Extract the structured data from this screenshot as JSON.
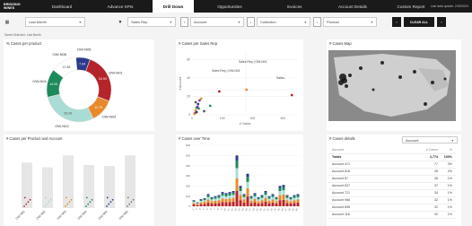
{
  "app": {
    "logo_line1": "BRIDGING",
    "logo_line2": "WINES",
    "last_modified": "Last data update: 2/25/2024"
  },
  "nav": {
    "tabs": [
      "Dashboard",
      "Advance KPIs",
      "Drill Down",
      "Opportunities",
      "Invoices",
      "Account Details",
      "Custom Report"
    ],
    "active": "Drill Down"
  },
  "filters": {
    "date_label": "Last Month",
    "sales_rep": "Sales Rep",
    "account": "Account",
    "collection": "Collection",
    "product": "Product",
    "clear_all": "CLEAR ALL",
    "selection_info": "Saved Selection: Last Month"
  },
  "cards": {
    "donut_title": "% Cases per product",
    "scatter_title": "# Cases per Sales Rep",
    "map_title": "# Cases Map",
    "bar_title": "# Cases per Product and Account",
    "stack_title": "# Cases over Time",
    "details_title": "# Cases details"
  },
  "donut": {
    "slices": [
      {
        "label": "OW-N01",
        "pct": "24.94",
        "value": 24.94,
        "color": "#b5242b"
      },
      {
        "label": "OW-N03",
        "pct": "11.79",
        "value": 11.79,
        "color": "#e88a2a"
      },
      {
        "label": "OW-N02",
        "pct": "28.28",
        "value": 28.28,
        "color": "#a9dcd4"
      },
      {
        "label": "OW-N04",
        "pct": "14.05",
        "value": 14.05,
        "color": "#1c8a5a"
      },
      {
        "label": "OW-N06",
        "pct": "12.88",
        "value": 12.88,
        "color": "#ffffff"
      },
      {
        "label": "OW-N05",
        "pct": "7.04",
        "value": 7.04,
        "color": "#2b3a8c"
      }
    ]
  },
  "scatter": {
    "ylabel": "# Account",
    "xlabel": "# Cases",
    "yticks": [
      "0",
      "20",
      "40",
      "60"
    ],
    "xticks": [
      "0",
      "100",
      "200",
      "300"
    ],
    "labels": [
      "Sales Rep | OW-N01",
      "Sales Rep | OW-N01",
      "Sales..."
    ]
  },
  "details": {
    "header_select": "Account",
    "col1": "Account",
    "col2": "# Cases",
    "col3": "%",
    "totals_label": "Totals",
    "totals_value": "2,774",
    "totals_pct": "100%",
    "rows": [
      {
        "name": "Account 471",
        "cases": "77",
        "pct": "3%"
      },
      {
        "name": "Account 816",
        "cases": "45",
        "pct": "2%"
      },
      {
        "name": "Account 87",
        "cases": "38",
        "pct": "1%"
      },
      {
        "name": "Account 837",
        "cases": "37",
        "pct": "1%"
      },
      {
        "name": "Account 721",
        "cases": "34",
        "pct": "1%"
      },
      {
        "name": "Account 966",
        "cases": "32",
        "pct": "1%"
      },
      {
        "name": "Account 838",
        "cases": "32",
        "pct": "1%"
      },
      {
        "name": "Account 116",
        "cases": "32",
        "pct": "1%"
      }
    ]
  },
  "chart_data": [
    {
      "type": "pie",
      "title": "% Cases per product",
      "categories": [
        "OW-N01",
        "OW-N03",
        "OW-N02",
        "OW-N04",
        "OW-N06",
        "OW-N05"
      ],
      "values": [
        24.94,
        11.79,
        28.28,
        14.05,
        12.88,
        7.04
      ]
    },
    {
      "type": "scatter",
      "title": "# Cases per Sales Rep",
      "xlabel": "# Cases",
      "ylabel": "# Account",
      "xlim": [
        0,
        350
      ],
      "ylim": [
        0,
        70
      ],
      "x": [
        10,
        12,
        15,
        20,
        25,
        30,
        40,
        60,
        90,
        180,
        330,
        15,
        8,
        22,
        18,
        12
      ],
      "y": [
        2,
        5,
        8,
        12,
        16,
        18,
        4,
        10,
        26,
        28,
        22,
        3,
        1,
        7,
        9,
        14
      ]
    },
    {
      "type": "bar",
      "title": "# Cases per Product and Account",
      "categories": [
        "OW-N01",
        "OW-N02",
        "OW-N03",
        "OW-N04",
        "OW-N05",
        "OW-N06"
      ],
      "values": [
        95,
        85,
        110,
        90,
        88,
        110
      ]
    },
    {
      "type": "bar",
      "title": "# Cases over Time",
      "ylim": [
        0,
        600
      ],
      "categories": [
        "1",
        "2",
        "3",
        "4",
        "5",
        "6",
        "7",
        "8",
        "9",
        "10",
        "11",
        "12",
        "13",
        "14",
        "15",
        "16",
        "17",
        "18",
        "19",
        "20",
        "21",
        "22",
        "23",
        "24",
        "25",
        "26",
        "27",
        "28",
        "29",
        "30"
      ],
      "values": [
        60,
        40,
        70,
        80,
        120,
        90,
        100,
        110,
        140,
        130,
        140,
        150,
        500,
        200,
        120,
        320,
        100,
        130,
        90,
        110,
        150,
        100,
        120,
        90,
        200,
        210,
        110,
        90,
        110,
        120
      ]
    }
  ]
}
